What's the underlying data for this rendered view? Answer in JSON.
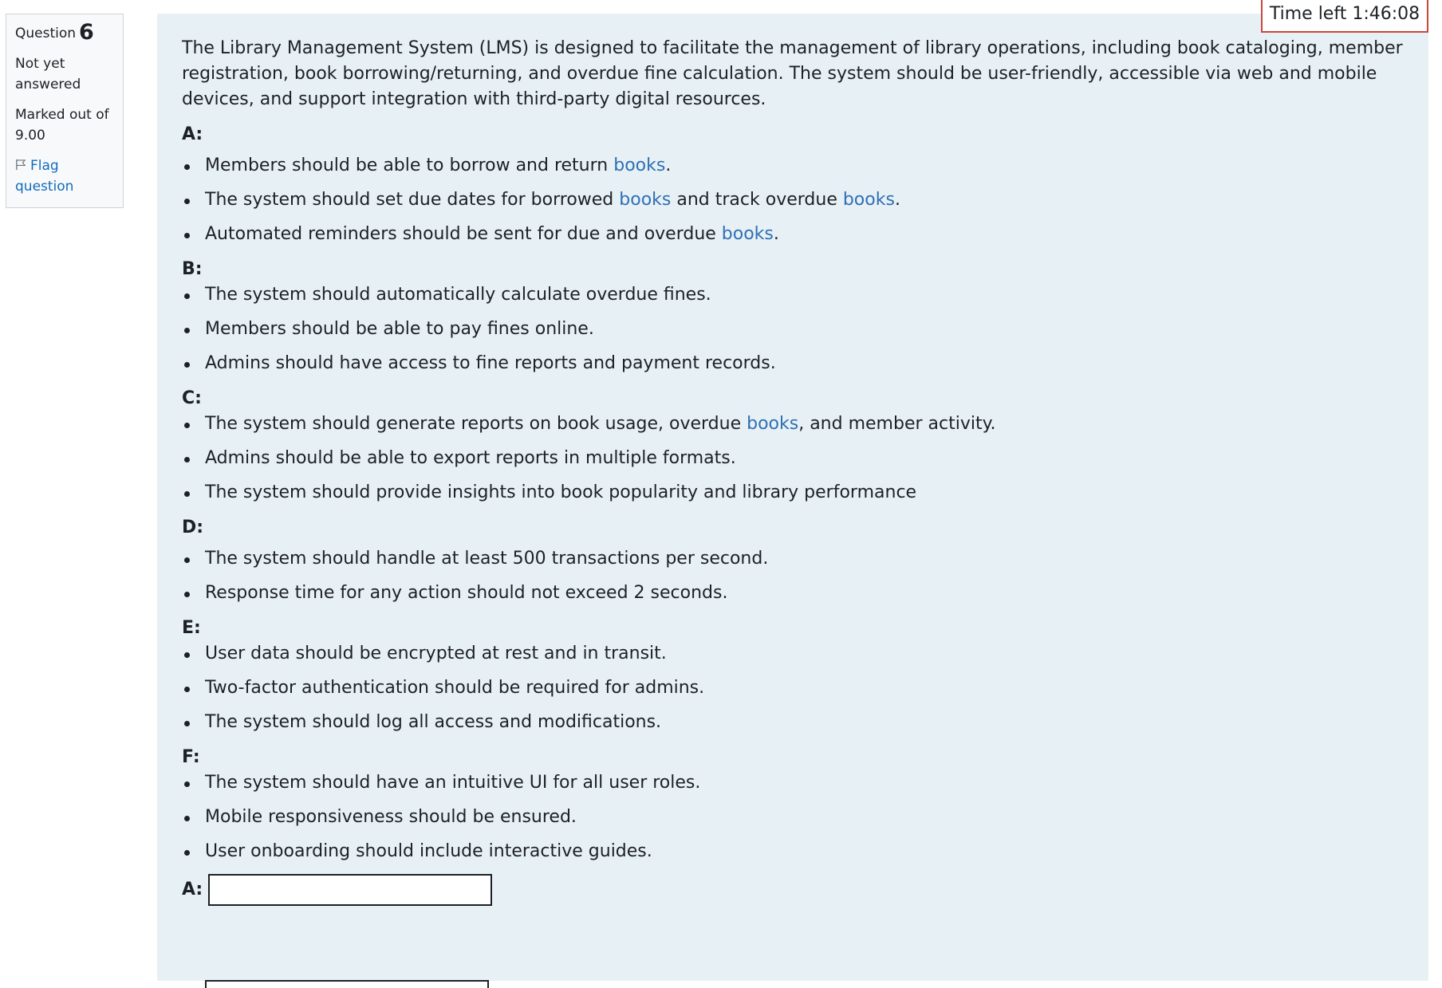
{
  "question_info": {
    "label": "Question",
    "number": "6",
    "status": "Not yet answered",
    "marks": "Marked out of 9.00",
    "flag_label": "Flag question"
  },
  "timer": {
    "text": "Time left 1:46:08"
  },
  "question": {
    "intro": "The Library Management System (LMS) is designed to facilitate the management of library operations, including book cataloging, member registration, book borrowing/returning, and overdue fine calculation. The system should be user-friendly, accessible via web and mobile devices, and support integration with third-party digital resources.",
    "link_word": "books",
    "sections": [
      {
        "label": "A:",
        "items": [
          {
            "before": "Members should be able to borrow and return ",
            "link": "books",
            "between": "",
            "link2": "",
            "after": "."
          },
          {
            "before": "The system should set due dates for borrowed ",
            "link": "books",
            "between": " and track overdue ",
            "link2": "books",
            "after": "."
          },
          {
            "before": "Automated reminders should be sent for due and overdue ",
            "link": "books",
            "between": "",
            "link2": "",
            "after": "."
          }
        ]
      },
      {
        "label": "B:",
        "items": [
          {
            "before": "The system should automatically calculate overdue fines.",
            "link": "",
            "between": "",
            "link2": "",
            "after": ""
          },
          {
            "before": "Members should be able to pay fines online.",
            "link": "",
            "between": "",
            "link2": "",
            "after": ""
          },
          {
            "before": "Admins should have access to fine reports and payment records.",
            "link": "",
            "between": "",
            "link2": "",
            "after": ""
          }
        ]
      },
      {
        "label": "C:",
        "items": [
          {
            "before": "The system should generate reports on book usage, overdue ",
            "link": "books",
            "between": "",
            "link2": "",
            "after": ", and member activity."
          },
          {
            "before": "Admins should be able to export reports in multiple formats.",
            "link": "",
            "between": "",
            "link2": "",
            "after": ""
          },
          {
            "before": "The system should provide insights into book popularity and library performance",
            "link": "",
            "between": "",
            "link2": "",
            "after": ""
          }
        ]
      },
      {
        "label": "D:",
        "items": [
          {
            "before": "The system should handle at least 500 transactions per second.",
            "link": "",
            "between": "",
            "link2": "",
            "after": ""
          },
          {
            "before": "Response time for any action should not exceed 2 seconds.",
            "link": "",
            "between": "",
            "link2": "",
            "after": ""
          }
        ]
      },
      {
        "label": "E:",
        "items": [
          {
            "before": "User data should be encrypted at rest and in transit.",
            "link": "",
            "between": "",
            "link2": "",
            "after": ""
          },
          {
            "before": "Two-factor authentication should be required for admins.",
            "link": "",
            "between": "",
            "link2": "",
            "after": ""
          },
          {
            "before": "The system should log all access and modifications.",
            "link": "",
            "between": "",
            "link2": "",
            "after": ""
          }
        ]
      },
      {
        "label": "F:",
        "items": [
          {
            "before": "The system should have an intuitive UI for all user roles.",
            "link": "",
            "between": "",
            "link2": "",
            "after": ""
          },
          {
            "before": "Mobile responsiveness should be ensured.",
            "link": "",
            "between": "",
            "link2": "",
            "after": ""
          },
          {
            "before": "User onboarding should include interactive guides.",
            "link": "",
            "between": "",
            "link2": "",
            "after": ""
          }
        ]
      }
    ],
    "answer_label": "A:",
    "answer_value": ""
  },
  "colors": {
    "content_bg": "#e7f1f5",
    "link": "#2f6fb5",
    "timer_border": "#c9473b"
  }
}
